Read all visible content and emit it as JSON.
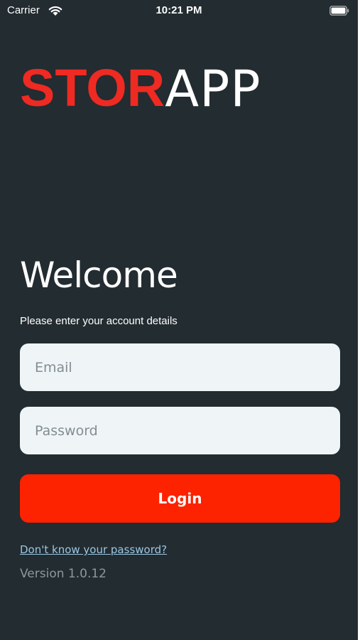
{
  "status_bar": {
    "carrier": "Carrier",
    "time": "10:21 PM",
    "wifi_icon": "wifi-icon",
    "battery_icon": "battery-icon"
  },
  "logo": {
    "bold_part": "STOR",
    "light_part": "APP",
    "bold_color": "#ee2a22",
    "light_color": "#ffffff"
  },
  "welcome": {
    "title": "Welcome",
    "subtitle": "Please enter your account details"
  },
  "form": {
    "email_placeholder": "Email",
    "email_value": "",
    "password_placeholder": "Password",
    "password_value": "",
    "login_label": "Login",
    "login_color": "#fd2200"
  },
  "footer": {
    "forgot_password": "Don't know your password?",
    "version": "Version 1.0.12"
  },
  "colors": {
    "background": "#222c31",
    "input_background": "#eff4f7",
    "link": "#9bc7e2"
  }
}
